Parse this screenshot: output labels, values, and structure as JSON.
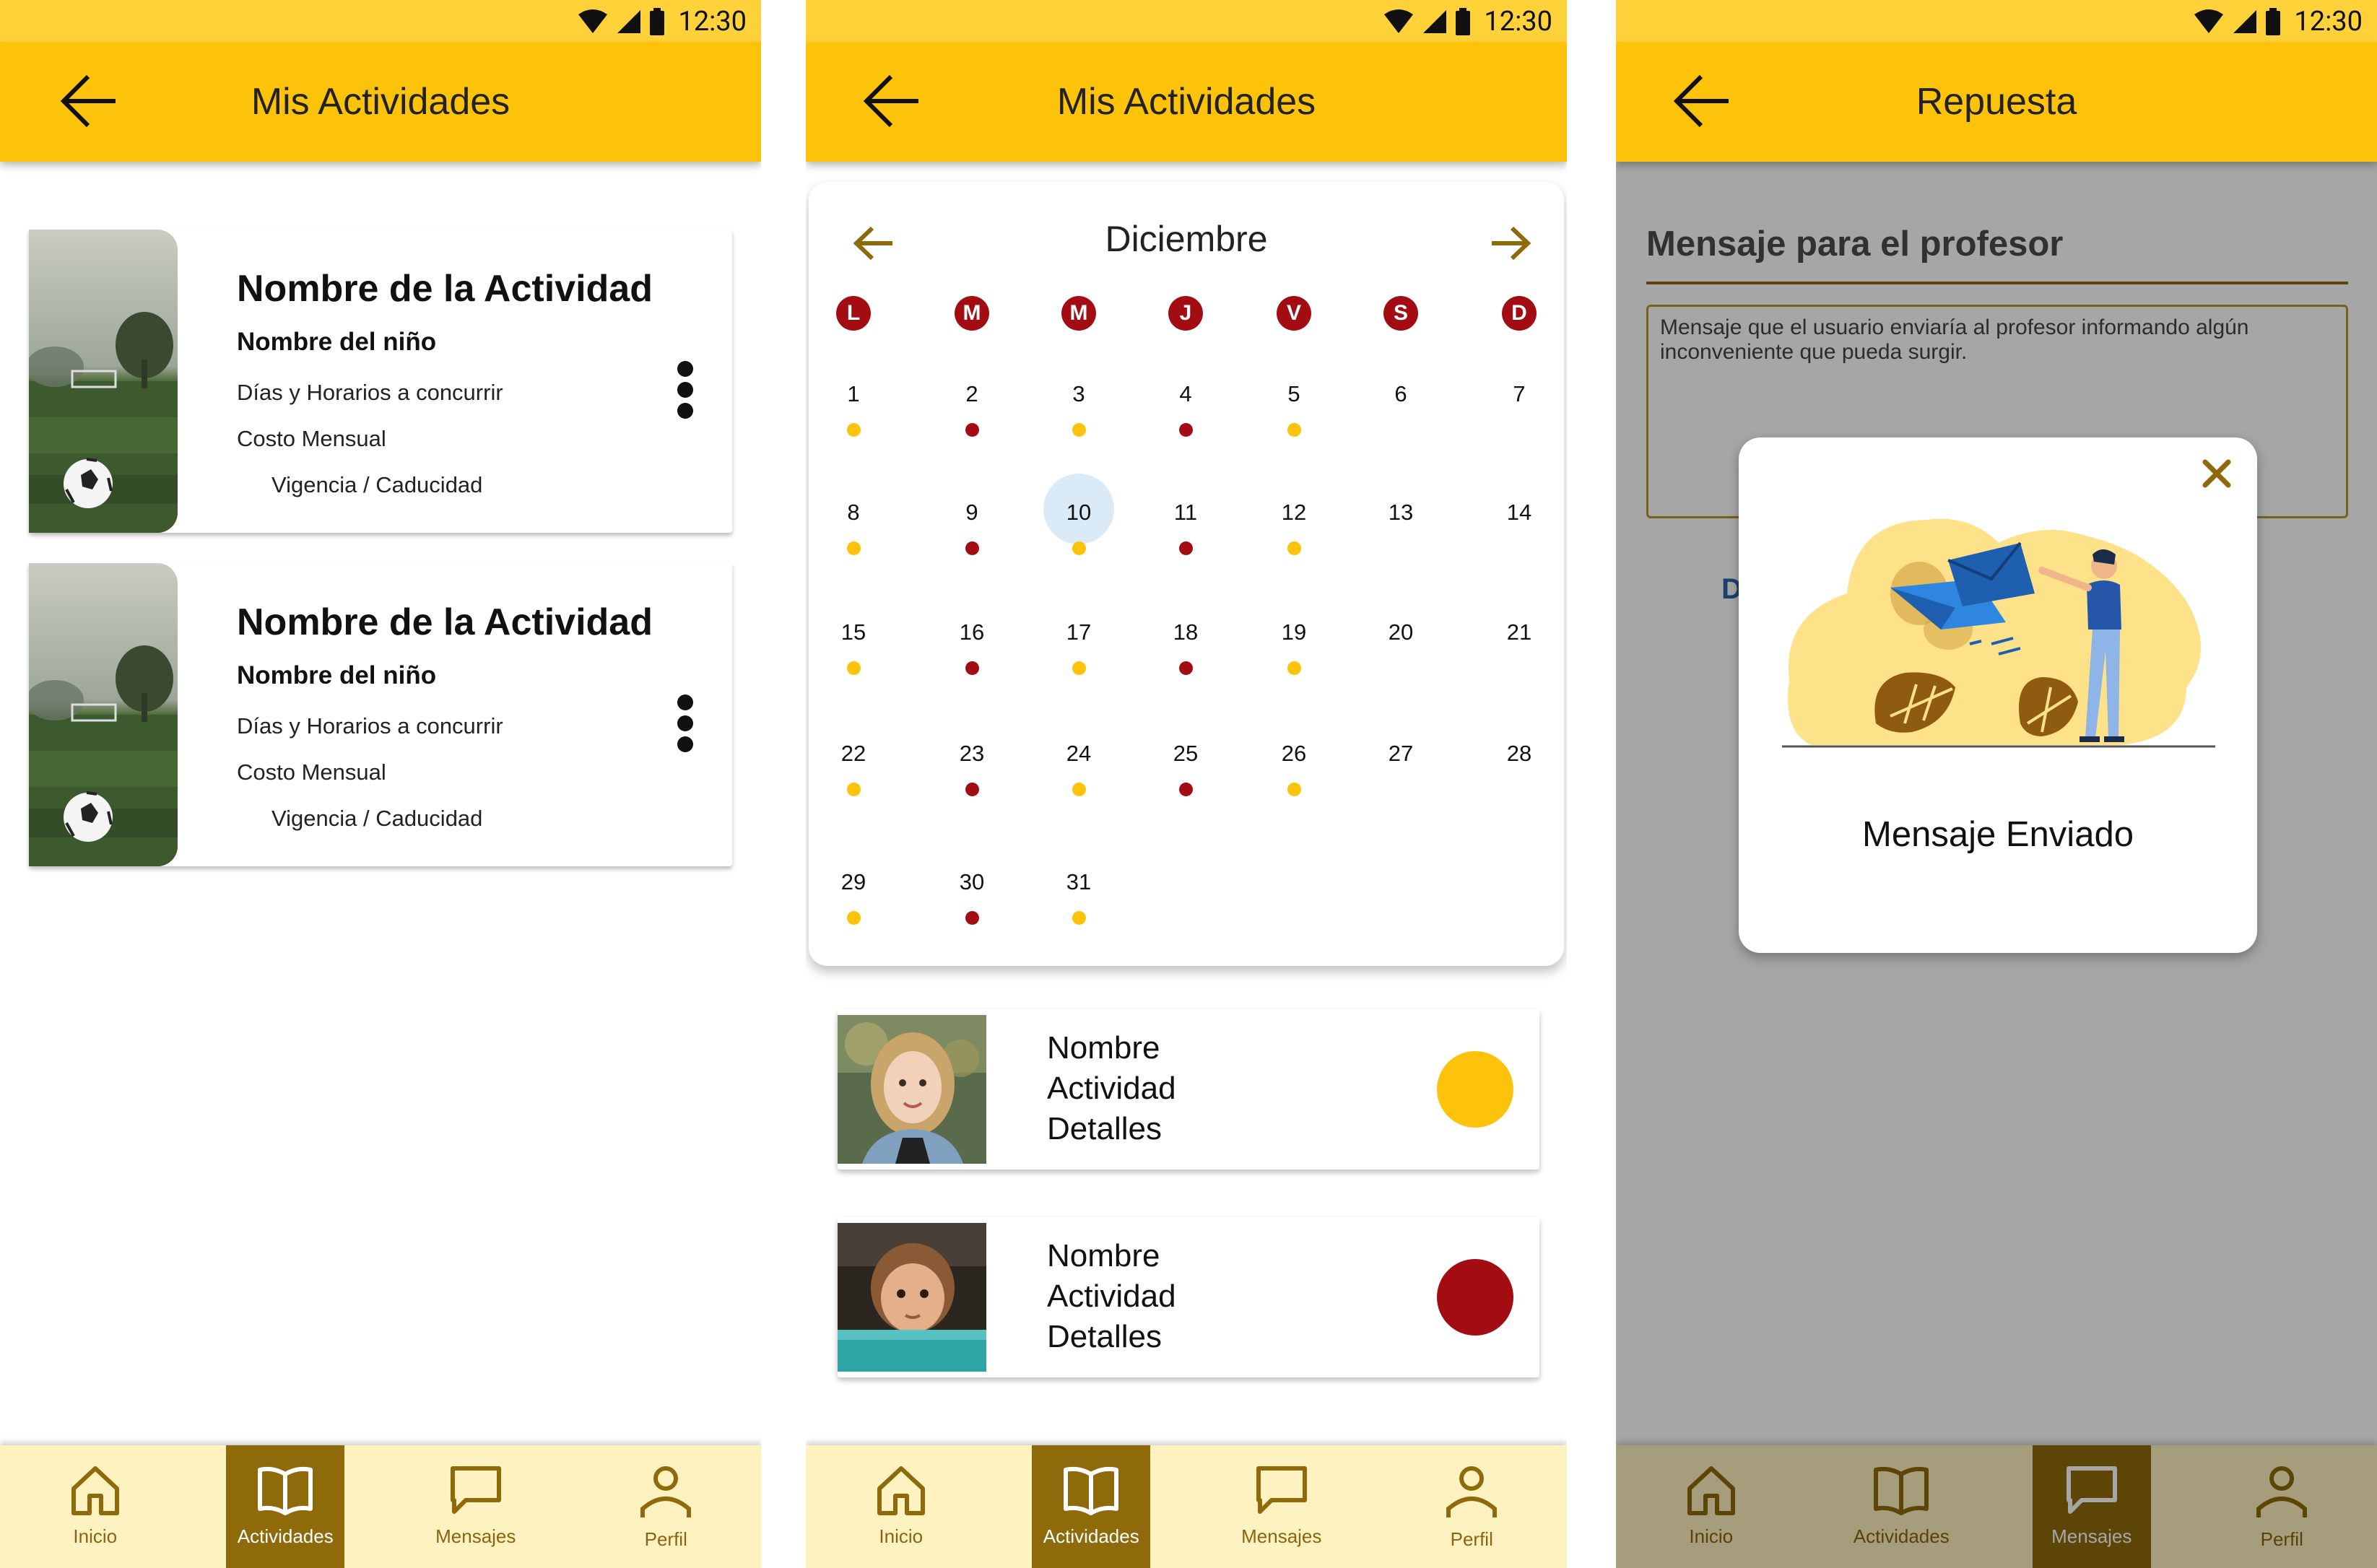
{
  "colors": {
    "primary": "#fdc20a",
    "statusbar": "#ffd23a",
    "accent_brown": "#8f6a0b",
    "nav_bg": "#fff2c1",
    "red_dot": "#a30c13",
    "yellow_dot": "#fdc20a",
    "today_bg": "#dbeaf7"
  },
  "status": {
    "time": "12:30"
  },
  "screen1": {
    "title": "Mis Actividades",
    "cards": [
      {
        "title": "Nombre de la Actividad",
        "child": "Nombre del niño",
        "days": "Días y Horarios a concurrir",
        "cost": "Costo Mensual",
        "validity": "Vigencia / Caducidad"
      },
      {
        "title": "Nombre de la Actividad",
        "child": "Nombre del niño",
        "days": "Días y Horarios a concurrir",
        "cost": "Costo Mensual",
        "validity": "Vigencia / Caducidad"
      }
    ]
  },
  "screen2": {
    "title": "Mis Actividades",
    "calendar": {
      "month": "Diciembre",
      "weekdays": [
        "L",
        "M",
        "M",
        "J",
        "V",
        "S",
        "D"
      ],
      "today": 10,
      "days": [
        {
          "n": "1",
          "dot": "yellow"
        },
        {
          "n": "2",
          "dot": "red"
        },
        {
          "n": "3",
          "dot": "yellow"
        },
        {
          "n": "4",
          "dot": "red"
        },
        {
          "n": "5",
          "dot": "yellow"
        },
        {
          "n": "6",
          "dot": ""
        },
        {
          "n": "7",
          "dot": ""
        },
        {
          "n": "8",
          "dot": "yellow"
        },
        {
          "n": "9",
          "dot": "red"
        },
        {
          "n": "10",
          "dot": "yellow"
        },
        {
          "n": "11",
          "dot": "red"
        },
        {
          "n": "12",
          "dot": "yellow"
        },
        {
          "n": "13",
          "dot": ""
        },
        {
          "n": "14",
          "dot": ""
        },
        {
          "n": "15",
          "dot": "yellow"
        },
        {
          "n": "16",
          "dot": "red"
        },
        {
          "n": "17",
          "dot": "yellow"
        },
        {
          "n": "18",
          "dot": "red"
        },
        {
          "n": "19",
          "dot": "yellow"
        },
        {
          "n": "20",
          "dot": ""
        },
        {
          "n": "21",
          "dot": ""
        },
        {
          "n": "22",
          "dot": "yellow"
        },
        {
          "n": "23",
          "dot": "red"
        },
        {
          "n": "24",
          "dot": "yellow"
        },
        {
          "n": "25",
          "dot": "red"
        },
        {
          "n": "26",
          "dot": "yellow"
        },
        {
          "n": "27",
          "dot": ""
        },
        {
          "n": "28",
          "dot": ""
        },
        {
          "n": "29",
          "dot": "yellow"
        },
        {
          "n": "30",
          "dot": "red"
        },
        {
          "n": "31",
          "dot": "yellow"
        }
      ]
    },
    "list": [
      {
        "text": "Nombre\nActividad\nDetalles",
        "dot": "yellow"
      },
      {
        "text": "Nombre\nActividad\nDetalles",
        "dot": "red"
      }
    ]
  },
  "screen3": {
    "title": "Repuesta",
    "message_title": "Mensaje para el profesor",
    "message_body": "Mensaje que el usuario enviaría al profesor informando algún inconveniente que pueda surgir.",
    "partial_button": "D",
    "dialog_text": "Mensaje Enviado"
  },
  "nav": {
    "items": [
      {
        "label": "Inicio",
        "icon": "home-icon"
      },
      {
        "label": "Actividades",
        "icon": "book-icon"
      },
      {
        "label": "Mensajes",
        "icon": "chat-icon"
      },
      {
        "label": "Perfil",
        "icon": "person-icon"
      }
    ],
    "active_screen1": 1,
    "active_screen2": 1,
    "active_screen3": 2
  }
}
